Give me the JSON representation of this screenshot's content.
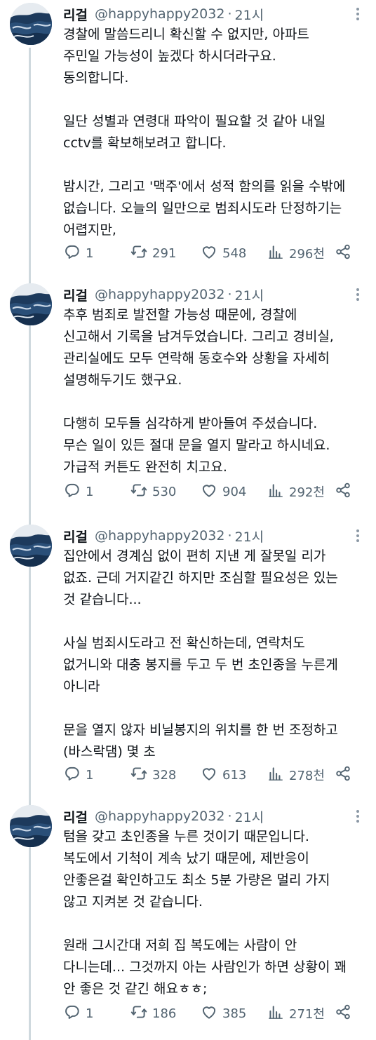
{
  "tweets": [
    {
      "name": "리걸",
      "handle": "@happyhappy2032",
      "separator": "·",
      "time": "21시",
      "lines": [
        "경찰에 말씀드리니 확신할 수 없지만, 아파트",
        "주민일 가능성이 높겠다 하시더라구요.",
        "동의합니다.",
        "",
        "일단 성별과 연령대 파악이 필요할 것 같아 내일",
        "cctv를 확보해보려고 합니다.",
        "",
        "밤시간, 그리고 '맥주'에서 성적 함의를 읽을 수밖에",
        "없습니다. 오늘의 일만으로 범죄시도라 단정하기는",
        "어렵지만,"
      ],
      "replies": "1",
      "retweets": "291",
      "likes": "548",
      "views": "296천"
    },
    {
      "name": "리걸",
      "handle": "@happyhappy2032",
      "separator": "·",
      "time": "21시",
      "lines": [
        "추후 범죄로 발전할 가능성 때문에, 경찰에",
        "신고해서 기록을 남겨두었습니다. 그리고 경비실,",
        "관리실에도 모두 연락해 동호수와 상황을 자세히",
        "설명해두기도 했구요.",
        "",
        "다행히 모두들 심각하게 받아들여 주셨습니다.",
        "무슨 일이 있든 절대 문을 열지 말라고 하시네요.",
        "가급적 커튼도 완전히 치고요."
      ],
      "replies": "1",
      "retweets": "530",
      "likes": "904",
      "views": "292천"
    },
    {
      "name": "리걸",
      "handle": "@happyhappy2032",
      "separator": "·",
      "time": "21시",
      "lines": [
        "집안에서 경계심 없이 편히 지낸 게 잘못일 리가",
        "없죠. 근데 거지같긴 하지만 조심할 필요성은 있는",
        "것 같습니다...",
        "",
        "사실 범죄시도라고 전 확신하는데, 연락처도",
        "없거니와 대충 봉지를 두고 두 번 초인종을 누른게",
        "아니라",
        "",
        "문을 열지 않자 비닐봉지의 위치를 한 번 조정하고",
        "(바스락댐) 몇 초"
      ],
      "replies": "1",
      "retweets": "328",
      "likes": "613",
      "views": "278천"
    },
    {
      "name": "리걸",
      "handle": "@happyhappy2032",
      "separator": "·",
      "time": "21시",
      "lines": [
        "텀을 갖고 초인종을 누른 것이기 때문입니다.",
        "복도에서 기척이 계속 났기 때문에, 제반응이",
        "안좋은걸 확인하고도 최소 5분 가량은 멀리 가지",
        "않고 지켜본 것 같습니다.",
        "",
        "원래 그시간대 저희 집 복도에는 사람이 안",
        "다니는데... 그것까지 아는 사람인가 하면 상황이 꽤",
        "안 좋은 것 같긴 해요ㅎㅎ;"
      ],
      "replies": "1",
      "retweets": "186",
      "likes": "385",
      "views": "271천"
    }
  ],
  "icons": {
    "reply": "reply-icon",
    "retweet": "retweet-icon",
    "like": "heart-icon",
    "views": "views-icon",
    "share": "share-icon",
    "more": "more-icon",
    "avatar": "avatar-image"
  },
  "colors": {
    "text": "#0f1419",
    "secondary": "#536471",
    "thread_line": "#cfd9de",
    "avatar_dark": "#1d3a5c"
  }
}
